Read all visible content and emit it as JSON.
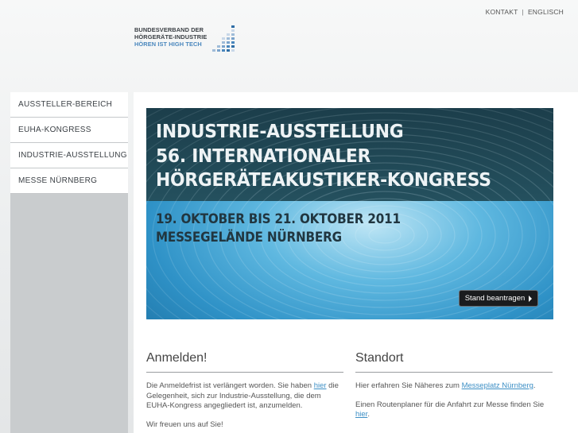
{
  "top_links": {
    "contact": "KONTAKT",
    "separator": "|",
    "english": "ENGLISCH"
  },
  "logo": {
    "line1": "BUNDESVERBAND DER",
    "line2": "HÖRGERÄTE-INDUSTRIE",
    "line3": "HÖREN IST HIGH TECH",
    "colors": {
      "dark": "#3a3f44",
      "accent": "#4a87bd"
    }
  },
  "sidebar": {
    "items": [
      {
        "label": "AUSSTELLER-BEREICH"
      },
      {
        "label": "EUHA-KONGRESS"
      },
      {
        "label": "INDUSTRIE-AUSSTELLUNG"
      },
      {
        "label": "MESSE NÜRNBERG"
      }
    ]
  },
  "banner": {
    "title_lines": [
      "INDUSTRIE-AUSSTELLUNG",
      "56. INTERNATIONALER",
      "HÖRGERÄTEAKUSTIKER-KONGRESS"
    ],
    "subtitle_lines": [
      "19. OKTOBER BIS 21. OKTOBER 2011",
      "MESSEGELÄNDE NÜRNBERG"
    ],
    "cta_label": "Stand beantragen"
  },
  "anmelden": {
    "heading": "Anmelden!",
    "p1_before": "Die Anmeldefrist ist verlängert worden. Sie haben ",
    "p1_link": "hier",
    "p1_after": " die Gelegenheit, sich zur Industrie-Ausstellung, die dem EUHA-Kongress angegliedert ist, anzumelden.",
    "p2": "Wir freuen uns auf Sie!"
  },
  "standort": {
    "heading": "Standort",
    "p1_before": "Hier erfahren Sie Näheres zum ",
    "p1_link": "Messeplatz Nürnberg",
    "p1_after": ".",
    "p2_before": "Einen Routenplaner für die Anfahrt zur Messe finden Sie ",
    "p2_link": "hier",
    "p2_after": "."
  }
}
